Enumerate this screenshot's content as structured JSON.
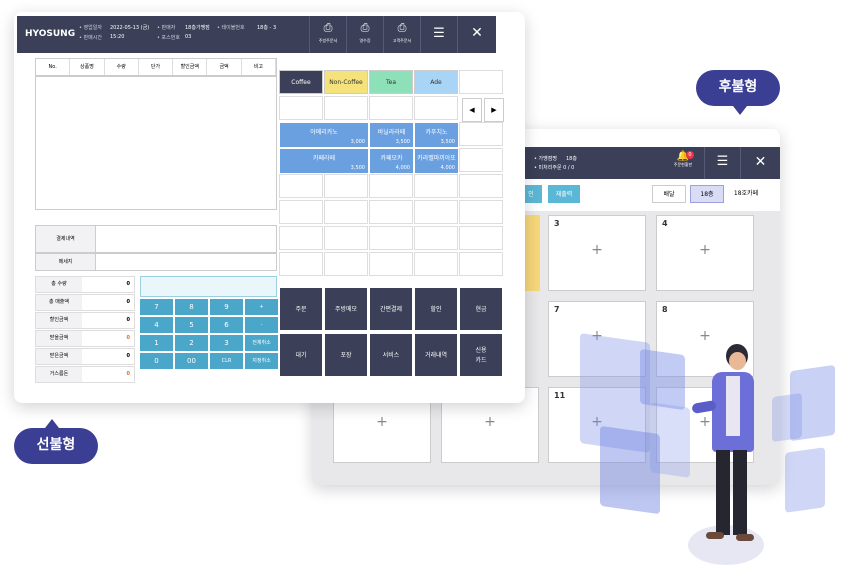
{
  "badges": {
    "prepaid": "선불형",
    "postpaid": "후불형"
  },
  "front": {
    "logo": "HYOSUNG",
    "meta": {
      "biz_date_label": "• 영업일자",
      "biz_date": "2022-05-13 (금)",
      "sale_time_label": "• 판매시간",
      "sale_time": "15:20",
      "seller_label": "• 판매자",
      "seller": "18층가맹점",
      "pos_label": "• 포스번호",
      "pos": "03",
      "table_label": "• 테이블번호",
      "table": "18층 - 3"
    },
    "header_buttons": [
      "주방주문서",
      "영수증",
      "고객주문서"
    ],
    "columns": [
      "No.",
      "상품명",
      "수량",
      "단가",
      "할인금액",
      "금액",
      "비고"
    ],
    "info": [
      {
        "k": "결제내역"
      },
      {
        "k": "메세지"
      }
    ],
    "summary": [
      {
        "k": "총 수량",
        "v": "0",
        "c": "#222"
      },
      {
        "k": "총 매출액",
        "v": "0",
        "c": "#222"
      },
      {
        "k": "할인금액",
        "v": "0",
        "c": "#222"
      },
      {
        "k": "받을금액",
        "v": "0",
        "c": "#e0702a"
      },
      {
        "k": "받은금액",
        "v": "0",
        "c": "#222"
      },
      {
        "k": "거스름돈",
        "v": "0",
        "c": "#e0702a"
      }
    ],
    "keypad": [
      "7",
      "8",
      "9",
      "+",
      "4",
      "5",
      "6",
      "-",
      "1",
      "2",
      "3",
      "전체취소",
      "0",
      "00",
      "CLR",
      "지정취소"
    ],
    "categories": [
      {
        "label": "Coffee",
        "bg": "#3b3f57",
        "fg": "#fff"
      },
      {
        "label": "Non-Coffee",
        "bg": "#f5e27a",
        "fg": "#333"
      },
      {
        "label": "Tea",
        "bg": "#8ee0b8",
        "fg": "#333"
      },
      {
        "label": "Ade",
        "bg": "#a8d4f5",
        "fg": "#333"
      }
    ],
    "nav": {
      "prev": "◀",
      "next": "▶"
    },
    "items": [
      {
        "name": "아메리카노",
        "price": "3,000"
      },
      {
        "name": "바닐라라떼",
        "price": "3,500"
      },
      {
        "name": "카푸치노",
        "price": "3,500"
      },
      {
        "name": "카페라떼",
        "price": "3,500"
      },
      {
        "name": "카페모카",
        "price": "4,000"
      },
      {
        "name": "카라멜마끼아또",
        "price": "4,000"
      }
    ],
    "actions": [
      "주문",
      "주방메모",
      "간편결제",
      "할인",
      "현금",
      "대기",
      "포장",
      "서비스",
      "거래내역",
      "신용\n카드"
    ]
  },
  "back": {
    "meta": [
      "• 가맹점명",
      "18층",
      "• 미처리주문 0 / 0"
    ],
    "notify": {
      "label": "주문현황판",
      "count": "0"
    },
    "tabs": [
      "인",
      "재출력"
    ],
    "floor_tabs": [
      "배달",
      "18층",
      "18호카페"
    ],
    "tiles": [
      {
        "n": "3",
        "p": "+"
      },
      {
        "n": "4",
        "p": "+"
      },
      {
        "n": "7",
        "p": "+"
      },
      {
        "n": "8",
        "p": "+"
      },
      {
        "n": "",
        "p": "+"
      },
      {
        "n": "",
        "p": "+"
      },
      {
        "n": "11",
        "p": "+"
      },
      {
        "n": "",
        "p": "+"
      }
    ]
  }
}
